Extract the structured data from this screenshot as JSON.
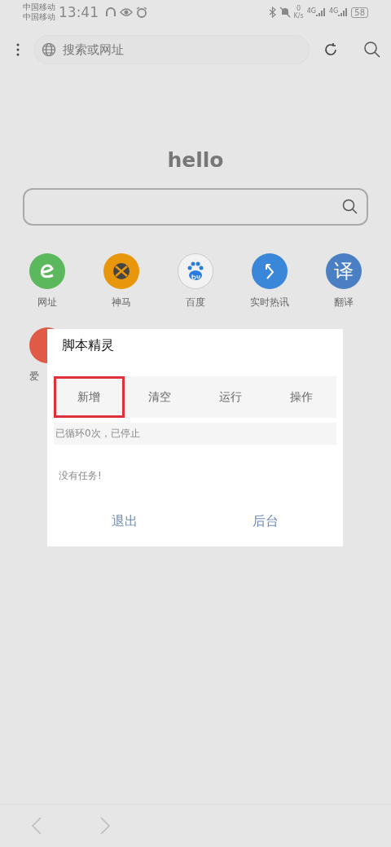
{
  "status_bar": {
    "carriers": [
      "中国移动",
      "中国移动"
    ],
    "time": "13:41",
    "net_speed": "0",
    "net_unit": "K/s",
    "signal_labels": [
      "4G",
      "4G"
    ],
    "battery": "58"
  },
  "toolbar": {
    "address_placeholder": "搜索或网址"
  },
  "home": {
    "title": "hello",
    "shortcuts": [
      {
        "kind": "e",
        "label": "网址",
        "color": "#5cb85c"
      },
      {
        "kind": "xbox",
        "label": "神马",
        "color": "#e8960c"
      },
      {
        "kind": "paw",
        "label": "百度",
        "color": "#f2f2f2"
      },
      {
        "kind": "arrow",
        "label": "实时热讯",
        "color": "#3a86d8"
      },
      {
        "kind": "glyph",
        "glyph": "译",
        "label": "翻译",
        "color": "#4a7fc4"
      },
      {
        "kind": "partial",
        "label": "爱",
        "color": "#e05a45"
      }
    ]
  },
  "dialog": {
    "title": "脚本精灵",
    "tabs": [
      {
        "label": "新增",
        "highlighted": true
      },
      {
        "label": "清空",
        "highlighted": false
      },
      {
        "label": "运行",
        "highlighted": false
      },
      {
        "label": "操作",
        "highlighted": false
      }
    ],
    "status": "已循环0次，已停止",
    "message": "没有任务!",
    "buttons": [
      "退出",
      "后台"
    ]
  }
}
